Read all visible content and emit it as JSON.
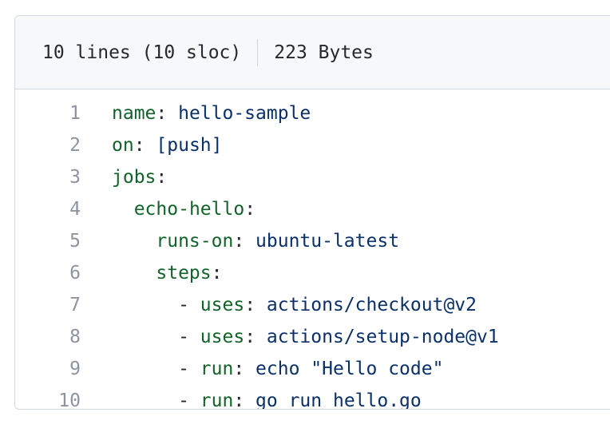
{
  "file_header": {
    "lines_info": "10 lines (10 sloc)",
    "size_info": "223 Bytes"
  },
  "code_lines": [
    {
      "num": "1",
      "indent": "",
      "dash": "",
      "key": "name",
      "sep": ": ",
      "value": "hello-sample"
    },
    {
      "num": "2",
      "indent": "",
      "dash": "",
      "key": "on",
      "sep": ": ",
      "value": "[push]"
    },
    {
      "num": "3",
      "indent": "",
      "dash": "",
      "key": "jobs",
      "sep": ":",
      "value": ""
    },
    {
      "num": "4",
      "indent": "  ",
      "dash": "",
      "key": "echo-hello",
      "sep": ":",
      "value": ""
    },
    {
      "num": "5",
      "indent": "    ",
      "dash": "",
      "key": "runs-on",
      "sep": ": ",
      "value": "ubuntu-latest"
    },
    {
      "num": "6",
      "indent": "    ",
      "dash": "",
      "key": "steps",
      "sep": ":",
      "value": ""
    },
    {
      "num": "7",
      "indent": "      ",
      "dash": "- ",
      "key": "uses",
      "sep": ": ",
      "value": "actions/checkout@v2"
    },
    {
      "num": "8",
      "indent": "      ",
      "dash": "- ",
      "key": "uses",
      "sep": ": ",
      "value": "actions/setup-node@v1"
    },
    {
      "num": "9",
      "indent": "      ",
      "dash": "- ",
      "key": "run",
      "sep": ": ",
      "value": "echo \"Hello code\""
    },
    {
      "num": "10",
      "indent": "      ",
      "dash": "- ",
      "key": "run",
      "sep": ": ",
      "value": "go run hello.go"
    }
  ],
  "colors": {
    "key": "#116329",
    "value": "#0a3069",
    "line_number": "#8c959f",
    "header_bg": "#f6f8fa",
    "border": "#d0d7de"
  }
}
